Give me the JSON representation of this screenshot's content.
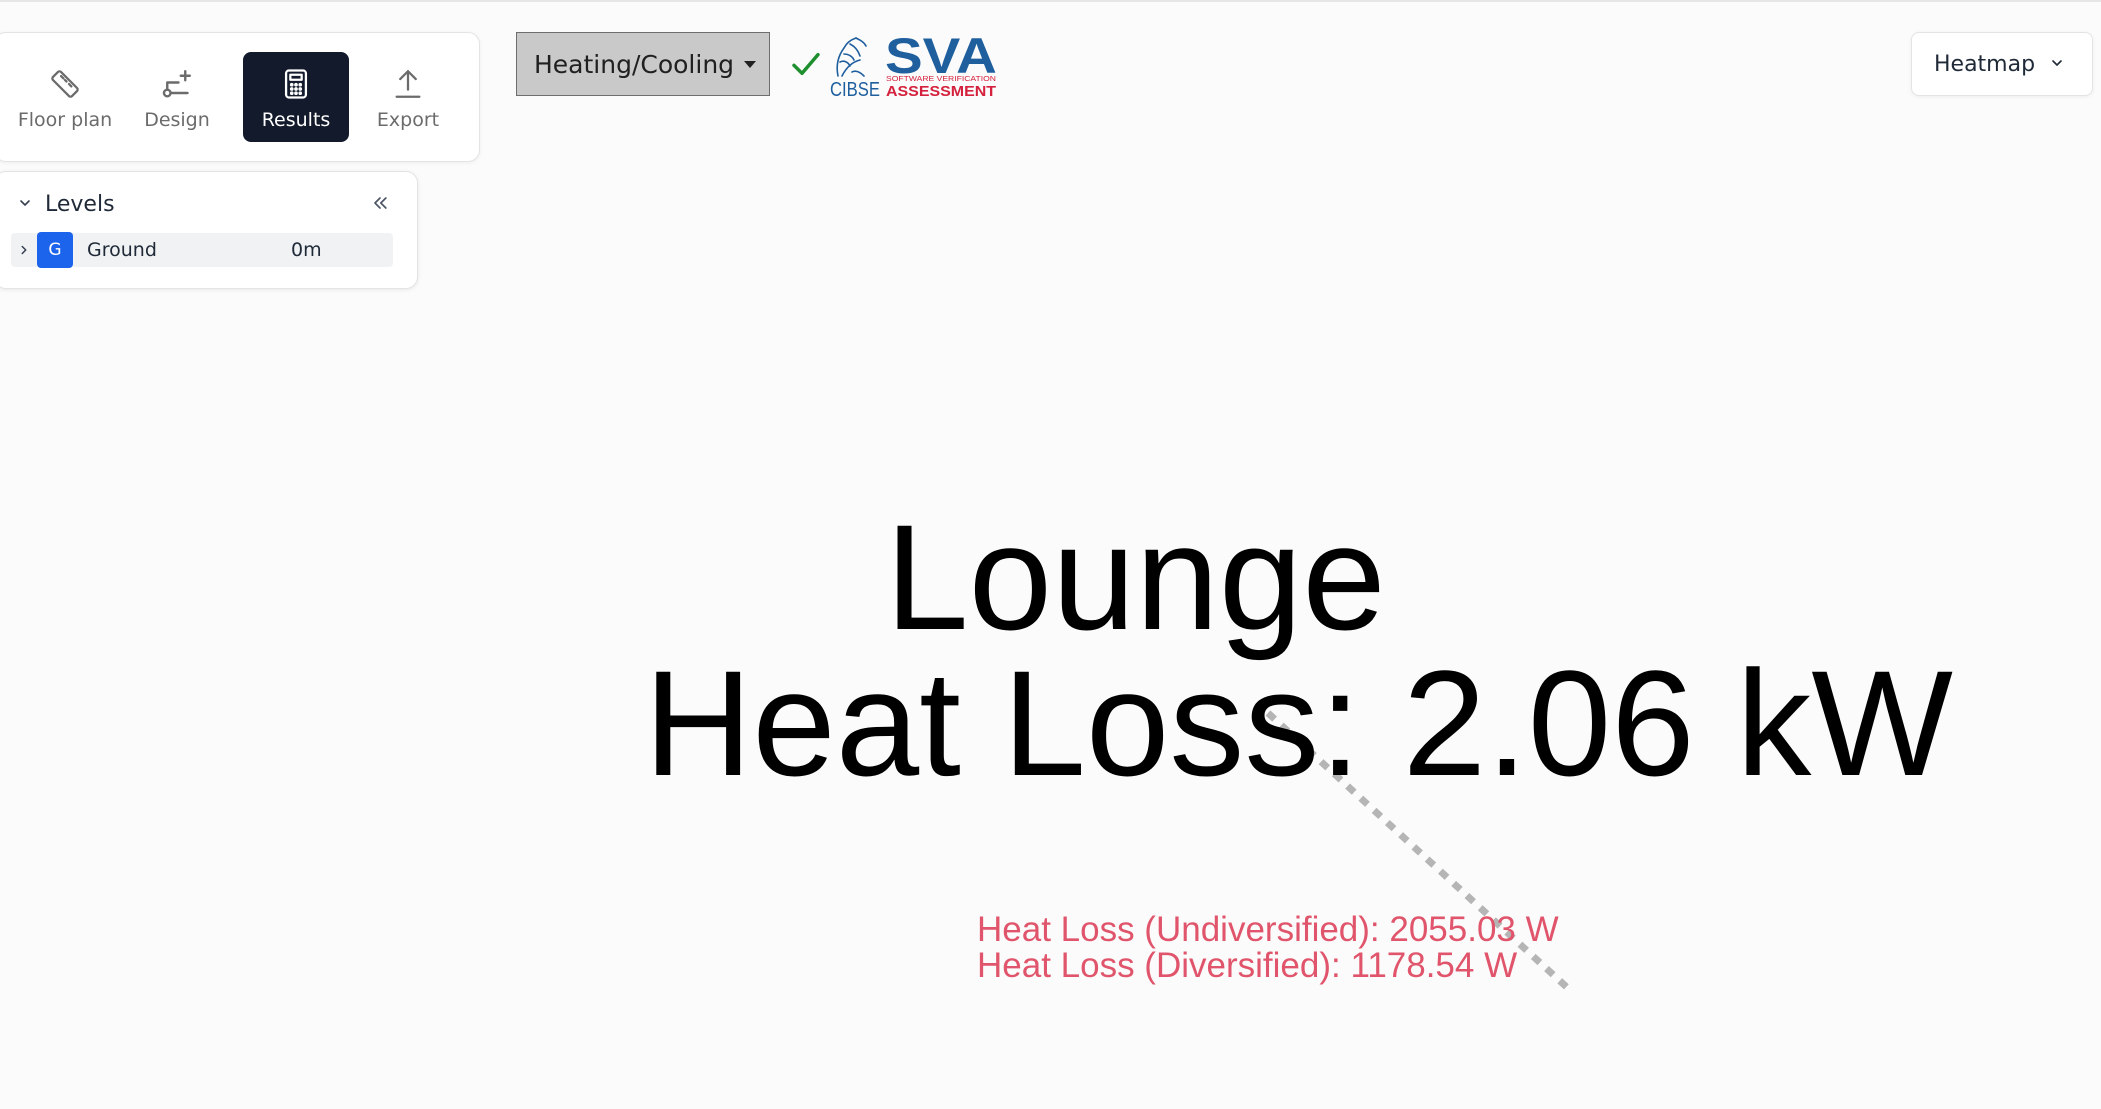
{
  "toolbar": {
    "tools": [
      {
        "label": "Floor plan",
        "icon": "ruler-icon",
        "active": false
      },
      {
        "label": "Design",
        "icon": "add-node-icon",
        "active": false
      },
      {
        "label": "Results",
        "icon": "calculator-icon",
        "active": true
      },
      {
        "label": "Export",
        "icon": "upload-icon",
        "active": false
      }
    ]
  },
  "levels": {
    "title": "Levels",
    "items": [
      {
        "badge": "G",
        "name": "Ground",
        "height": "0m"
      }
    ]
  },
  "mode": {
    "selected": "Heating/Cooling"
  },
  "logo": {
    "brand": "SVA",
    "org": "CIBSE",
    "tagline": "SOFTWARE VERIFICATION",
    "subtitle": "ASSESSMENT"
  },
  "view": {
    "selected": "Heatmap"
  },
  "canvas": {
    "room_name": "Lounge",
    "room_load": "Heat Loss: 2.06 kW",
    "details": [
      "Heat Loss (Undiversified): 2055.03 W",
      "Heat Loss (Diversified): 1178.54 W"
    ]
  },
  "colors": {
    "active_tool_bg": "#131a2b",
    "level_badge": "#1d64ec",
    "check": "#1e8f2e",
    "detail_text": "#e0556b",
    "logo_blue": "#1f5f9e",
    "logo_red": "#d4213d"
  }
}
